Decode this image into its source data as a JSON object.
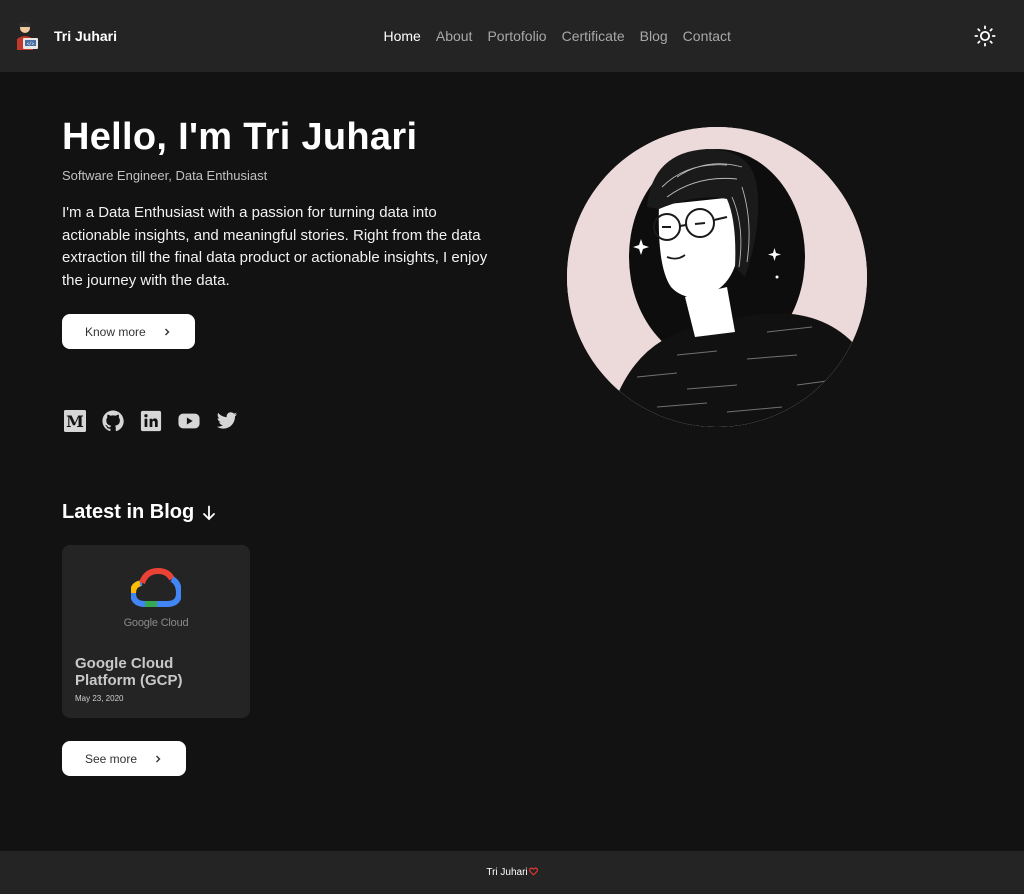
{
  "navbar": {
    "brand_name": "Tri Juhari",
    "links": [
      {
        "label": "Home",
        "active": true
      },
      {
        "label": "About",
        "active": false
      },
      {
        "label": "Portofolio",
        "active": false
      },
      {
        "label": "Certificate",
        "active": false
      },
      {
        "label": "Blog",
        "active": false
      },
      {
        "label": "Contact",
        "active": false
      }
    ],
    "theme_icon": "sun-icon"
  },
  "hero": {
    "title": "Hello, I'm Tri Juhari",
    "subtitle": "Software Engineer, Data Enthusiast",
    "description": "I'm a Data Enthusiast with a passion for turning data into actionable insights, and meaningful stories. Right from the data extraction till the final data product or actionable insights, I enjoy the journey with the data.",
    "cta_label": "Know more"
  },
  "social": [
    {
      "name": "medium-icon"
    },
    {
      "name": "github-icon"
    },
    {
      "name": "linkedin-icon"
    },
    {
      "name": "youtube-icon"
    },
    {
      "name": "twitter-icon"
    }
  ],
  "blog": {
    "heading": "Latest in Blog",
    "posts": [
      {
        "logo_text": "Google Cloud",
        "title": "Google Cloud Platform (GCP)",
        "date": "May 23, 2020"
      }
    ],
    "see_more_label": "See more"
  },
  "footer": {
    "text": "Tri Juhari"
  },
  "colors": {
    "background": "#121212",
    "surface": "#242424",
    "heart": "#e53935",
    "avatar_bg": "#ecd9da"
  }
}
